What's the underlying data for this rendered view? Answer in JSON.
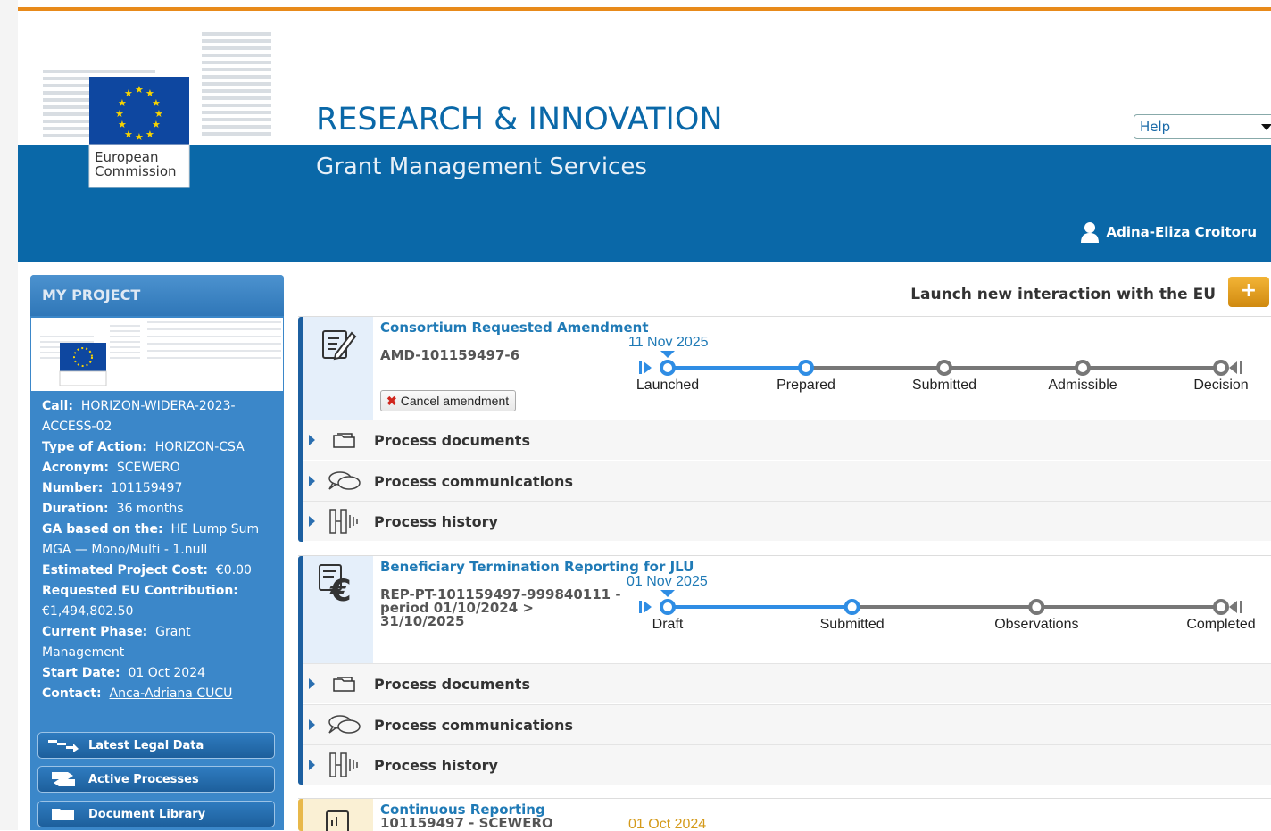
{
  "header": {
    "title": "RESEARCH & INNOVATION",
    "subtitle": "Grant Management Services",
    "logo_text_line1": "European",
    "logo_text_line2": "Commission",
    "help_select": "Help",
    "user_name": "Adina-Eliza Croitoru"
  },
  "sidebar": {
    "heading": "MY PROJECT",
    "call_label": "Call:",
    "call_value": "HORIZON-WIDERA-2023-ACCESS-02",
    "type_label": "Type of Action:",
    "type_value": "HORIZON-CSA",
    "acronym_label": "Acronym:",
    "acronym_value": "SCEWERO",
    "number_label": "Number:",
    "number_value": "101159497",
    "duration_label": "Duration:",
    "duration_value": "36 months",
    "ga_label": "GA based on the:",
    "ga_value": "HE Lump Sum MGA — Mono/Multi - 1.null",
    "cost_label": "Estimated Project Cost:",
    "cost_value": "€0.00",
    "contrib_label": "Requested EU Contribution:",
    "contrib_value": "€1,494,802.50",
    "phase_label": "Current Phase:",
    "phase_value": "Grant Management",
    "start_label": "Start Date:",
    "start_value": "01 Oct 2024",
    "contact_label": "Contact:",
    "contact_value": "Anca-Adriana CUCU",
    "buttons": [
      "Latest Legal Data",
      "Active Processes",
      "Document Library"
    ]
  },
  "main": {
    "launch_text": "Launch new interaction with the EU",
    "launch_button": "+",
    "rows": [
      "Process documents",
      "Process communications",
      "Process history"
    ],
    "processes": [
      {
        "title": "Consortium Requested Amendment",
        "code": "AMD-101159497-6",
        "action": "Cancel amendment",
        "date": "11 Nov 2025",
        "steps": [
          "Launched",
          "Prepared",
          "Submitted",
          "Admissible",
          "Decision"
        ],
        "current_step": 2
      },
      {
        "title": "Beneficiary Termination Reporting for JLU",
        "code": "REP-PT-101159497-999840111 - period 01/10/2024 > 31/10/2025",
        "date": "01 Nov 2025",
        "steps": [
          "Draft",
          "Submitted",
          "Observations",
          "Completed"
        ],
        "current_step": 2
      },
      {
        "title": "Continuous Reporting",
        "code": "101159497 - SCEWERO",
        "date": "01 Oct 2024"
      }
    ]
  },
  "colors": {
    "brand_blue": "#0a68a8",
    "accent_orange": "#e88a1a",
    "sidebar_blue": "#3b87c9",
    "timeline_blue": "#2f8de4"
  }
}
